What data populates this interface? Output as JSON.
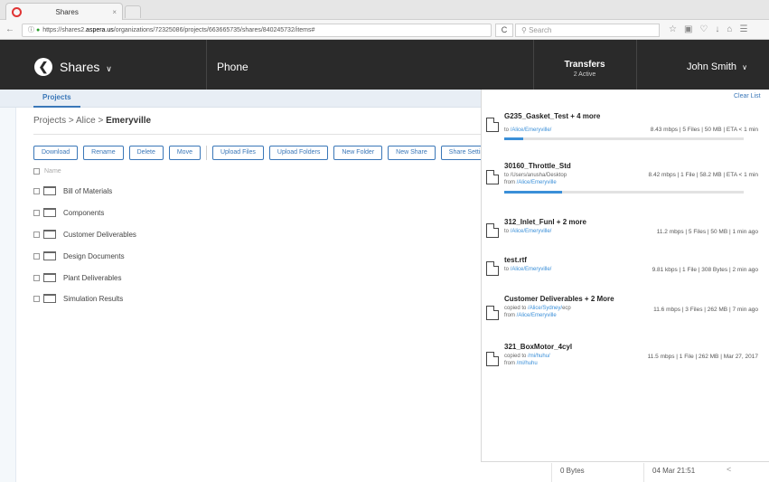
{
  "browser": {
    "tab_title": "Shares",
    "tab_close": "×",
    "url_prefix": "https://shares2.",
    "url_domain": "aspera.us",
    "url_path": "/organizations/72325086/projects/663665735/shares/840245732/items#",
    "reload": "C",
    "search_placeholder": "Search"
  },
  "header": {
    "app_title": "Shares",
    "app_chevron": "∨",
    "workspace": "Phone",
    "transfers_label": "Transfers",
    "transfers_sub": "2 Active",
    "user_name": "John Smith",
    "user_chevron": "∨"
  },
  "subnav": {
    "projects_tab": "Projects"
  },
  "breadcrumb": {
    "part1": "Projects",
    "sep1": ">",
    "part2": "Alice",
    "sep2": ">",
    "current": "Emeryville"
  },
  "toolbar": {
    "download": "Download",
    "rename": "Rename",
    "delete": "Delete",
    "move": "Move",
    "upload_files": "Upload Files",
    "upload_folders": "Upload Folders",
    "new_folder": "New Folder",
    "new_share": "New Share",
    "share_settings": "Share Settings"
  },
  "list": {
    "name_header": "Name",
    "items": [
      "Bill of Materials",
      "Components",
      "Customer Deliverables",
      "Design Documents",
      "Plant Deliverables",
      "Simulation Results"
    ]
  },
  "transfers_panel": {
    "clear_list": "Clear List",
    "items": [
      {
        "name": "G235_Gasket_Test + 4 more",
        "to_pre": "to ",
        "to_link": "/Alice/Emeryville/",
        "from_pre": "",
        "from_link": "",
        "stats": "8.43 mbps | 5 Files | 50 MB | ETA < 1 min",
        "progress": 0.08
      },
      {
        "name": "30160_Throttle_Std",
        "to_pre": "to /Users/anusha/Desktop",
        "to_link": "",
        "from_pre": "from ",
        "from_link": "/Alice/Emeryville",
        "stats": "8.42 mbps | 1 File | 58.2 MB | ETA < 1 min",
        "progress": 0.24
      },
      {
        "name": "312_Inlet_Funl + 2 more",
        "to_pre": "to ",
        "to_link": "/Alice/Emeryville/",
        "from_pre": "",
        "from_link": "",
        "stats": "11.2 mbps | 5 Files | 50 MB | 1 min ago"
      },
      {
        "name": "test.rtf",
        "to_pre": "to ",
        "to_link": "/Alice/Emeryville/",
        "from_pre": "",
        "from_link": "",
        "stats": "9.81 kbps | 1 File | 308 Bytes | 2 min ago"
      },
      {
        "name": "Customer Deliverables + 2 More",
        "to_pre": "copied to ",
        "to_link": "/Alice/Sydney/",
        "to_post": "ecp",
        "from_pre": "from ",
        "from_link": "/Alice/Emeryville",
        "stats": "11.6 mbps | 3 Files | 262 MB | 7 min ago"
      },
      {
        "name": "321_BoxMotor_4cyl",
        "to_pre": "copied to ",
        "to_link": "/mi/huhu/",
        "to_post": "",
        "from_pre": "from ",
        "from_link": "/mi/huhu",
        "stats": "11.5 mbps | 1 File | 262 MB | Mar 27, 2017"
      }
    ]
  },
  "footer": {
    "size": "0 Bytes",
    "date": "04 Mar 21:51",
    "share_icon": "<"
  },
  "colors": {
    "header_bg": "#2a2a2a",
    "accent": "#3a77b8",
    "link": "#3a8fd8"
  }
}
